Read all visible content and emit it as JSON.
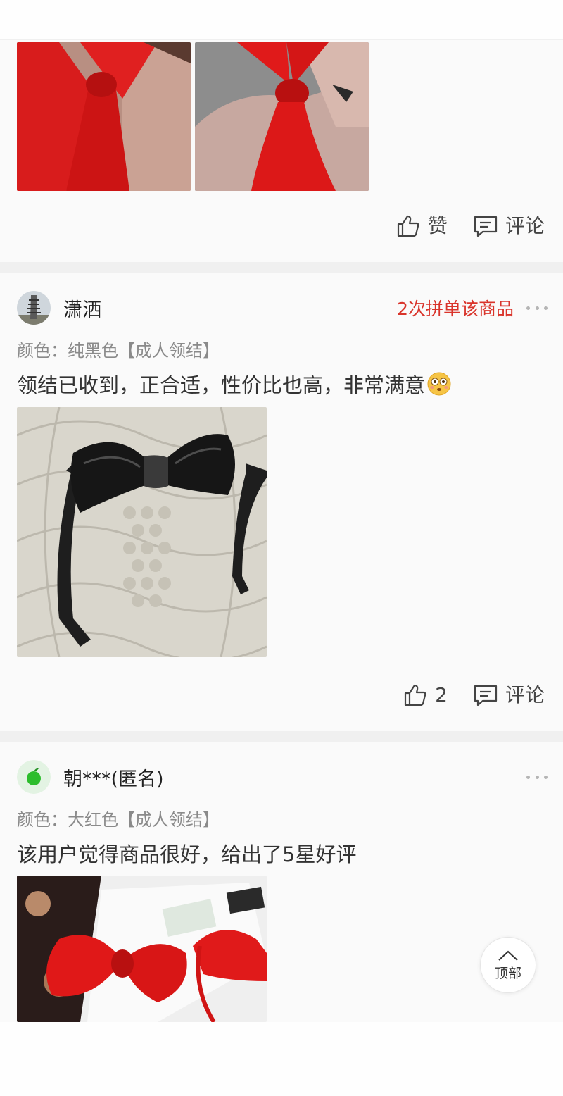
{
  "review1": {
    "like_label": "赞",
    "comment_label": "评论"
  },
  "review2": {
    "username": "潇洒",
    "badge": "2次拼单该商品",
    "spec": "颜色：纯黑色【成人领结】",
    "text": "领结已收到，正合适，性价比也高，非常满意",
    "like_count": "2",
    "comment_label": "评论"
  },
  "review3": {
    "username": "朝***(匿名)",
    "spec": "颜色：大红色【成人领结】",
    "text": "该用户觉得商品很好，给出了5星好评"
  },
  "back_to_top": {
    "label": "顶部"
  },
  "colors": {
    "badge_red": "#d9342b",
    "spec_gray": "#8a8a8a",
    "separator": "#f0f0f0"
  }
}
